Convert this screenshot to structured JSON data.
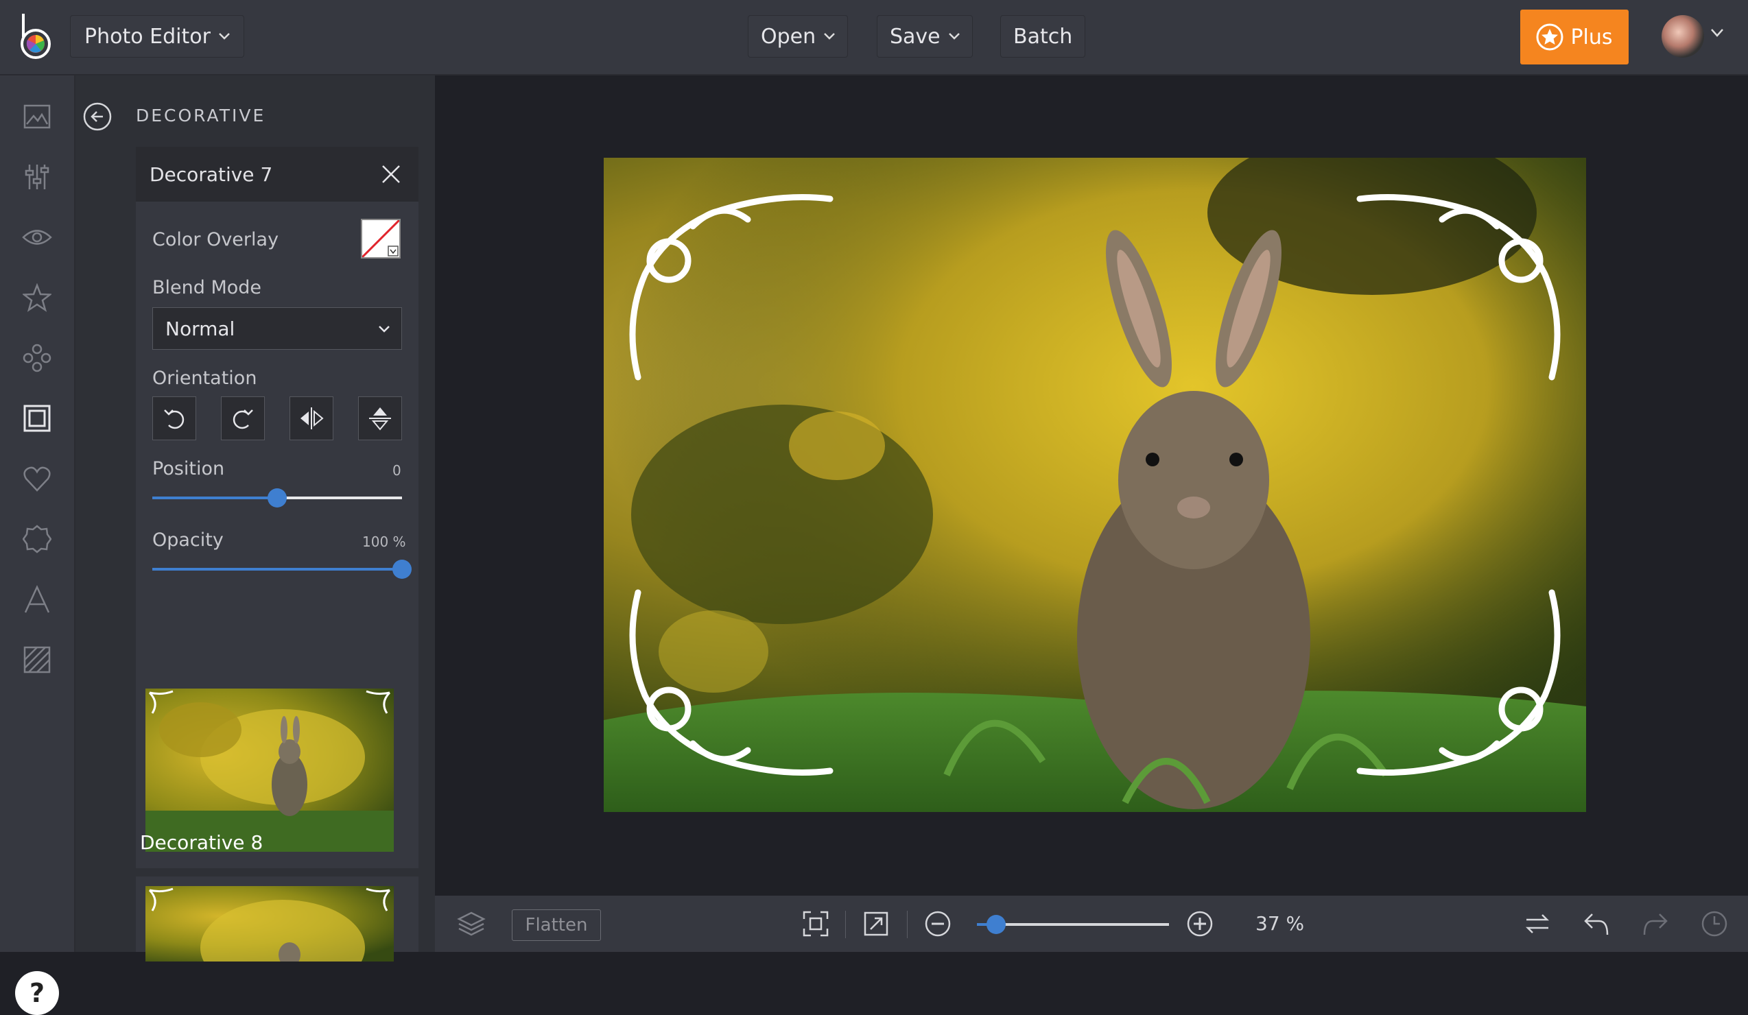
{
  "topbar": {
    "app_menu_label": "Photo Editor",
    "open_label": "Open",
    "save_label": "Save",
    "batch_label": "Batch",
    "plus_label": "Plus"
  },
  "rail": {
    "icons": [
      "image-icon",
      "adjust-sliders-icon",
      "eye-icon",
      "star-icon",
      "effects-icon",
      "frame-icon",
      "heart-icon",
      "badge-icon",
      "text-icon",
      "texture-icon"
    ],
    "help_label": "?"
  },
  "panel": {
    "title": "DECORATIVE",
    "card": {
      "title": "Decorative 7",
      "color_overlay_label": "Color Overlay",
      "blend_mode_label": "Blend Mode",
      "blend_mode_value": "Normal",
      "orientation_label": "Orientation",
      "position_label": "Position",
      "position_value": "0",
      "position_fraction": 0.5,
      "opacity_label": "Opacity",
      "opacity_value": "100 %",
      "opacity_fraction": 1.0
    },
    "thumbnails": [
      {
        "label": "Decorative 8"
      },
      {
        "label": ""
      }
    ]
  },
  "bottombar": {
    "flatten_label": "Flatten",
    "zoom_value": "37 %",
    "zoom_fraction": 0.1
  },
  "colors": {
    "accent": "#3a7fd5",
    "plus": "#f5851f"
  }
}
